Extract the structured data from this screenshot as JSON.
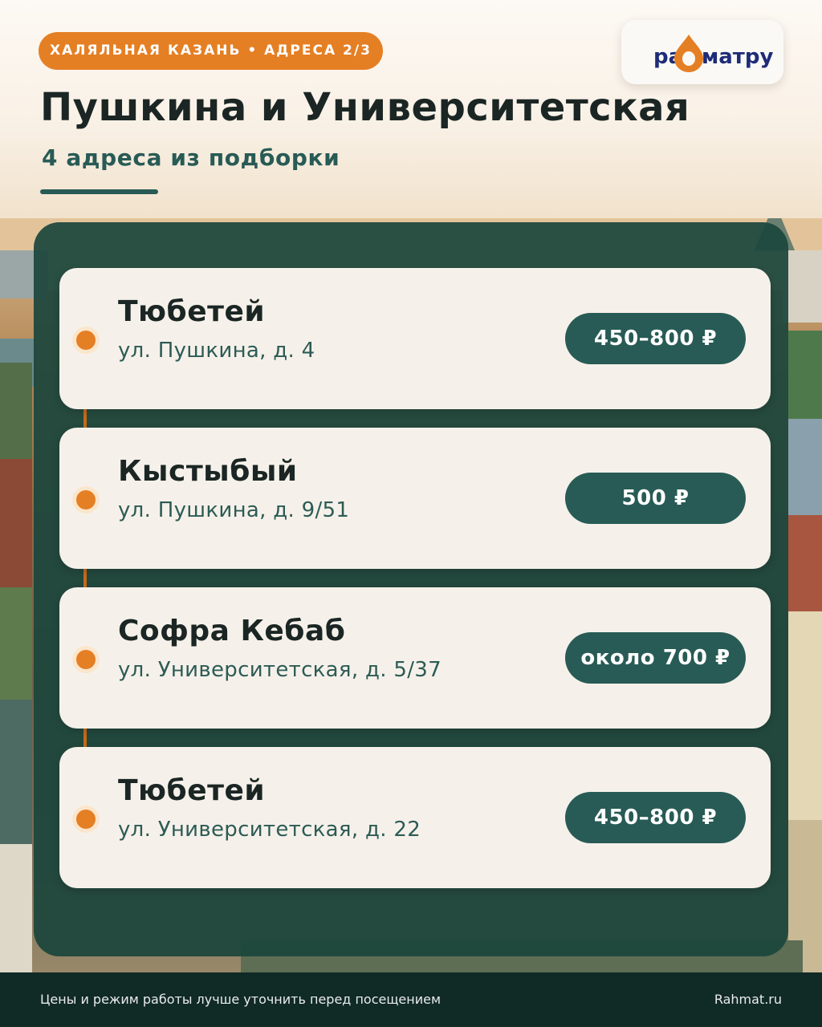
{
  "header": {
    "badge": "ХАЛЯЛЬНАЯ КАЗАНЬ • АДРЕСА 2/3",
    "title": "Пушкина и Университетская",
    "subtitle": "4 адреса из подборки"
  },
  "logo": {
    "text_left": "ра",
    "text_right": "матру"
  },
  "colors": {
    "accent_orange": "#e57f24",
    "dark_green": "#285b55",
    "panel_green": "#1c463c",
    "card_bg": "#f5f1ea",
    "logo_blue": "#1e2c78"
  },
  "places": [
    {
      "name": "Тюбетей",
      "address": "ул. Пушкина, д. 4",
      "price": "450–800 ₽"
    },
    {
      "name": "Кыстыбый",
      "address": "ул. Пушкина, д. 9/51",
      "price": "500 ₽"
    },
    {
      "name": "Софра Кебаб",
      "address": "ул. Университетская, д. 5/37",
      "price": "около 700 ₽"
    },
    {
      "name": "Тюбетей",
      "address": "ул. Университетская, д. 22",
      "price": "450–800 ₽"
    }
  ],
  "footer": {
    "note": "Цены и режим работы лучше уточнить перед посещением",
    "site": "Rahmat.ru"
  }
}
